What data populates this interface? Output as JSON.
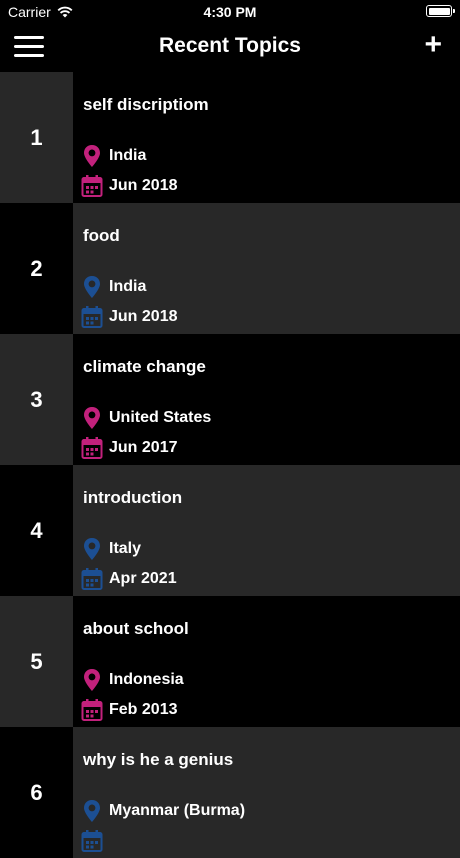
{
  "status_bar": {
    "carrier": "Carrier",
    "time": "4:30 PM"
  },
  "nav": {
    "title": "Recent Topics",
    "add_label": "+"
  },
  "colors": {
    "pink": "#c2217c",
    "blue": "#1c4f93"
  },
  "rows": [
    {
      "number": "1",
      "topic": "self discriptiom",
      "location": "India",
      "date": "Jun 2018",
      "icon_color": "pink"
    },
    {
      "number": "2",
      "topic": "food",
      "location": "India",
      "date": "Jun 2018",
      "icon_color": "blue"
    },
    {
      "number": "3",
      "topic": "climate change",
      "location": "United States",
      "date": "Jun 2017",
      "icon_color": "pink"
    },
    {
      "number": "4",
      "topic": "introduction",
      "location": "Italy",
      "date": "Apr 2021",
      "icon_color": "blue"
    },
    {
      "number": "5",
      "topic": "about school",
      "location": "Indonesia",
      "date": "Feb 2013",
      "icon_color": "pink"
    },
    {
      "number": "6",
      "topic": "why is he a genius",
      "location": "Myanmar (Burma)",
      "date": "",
      "icon_color": "blue"
    }
  ]
}
